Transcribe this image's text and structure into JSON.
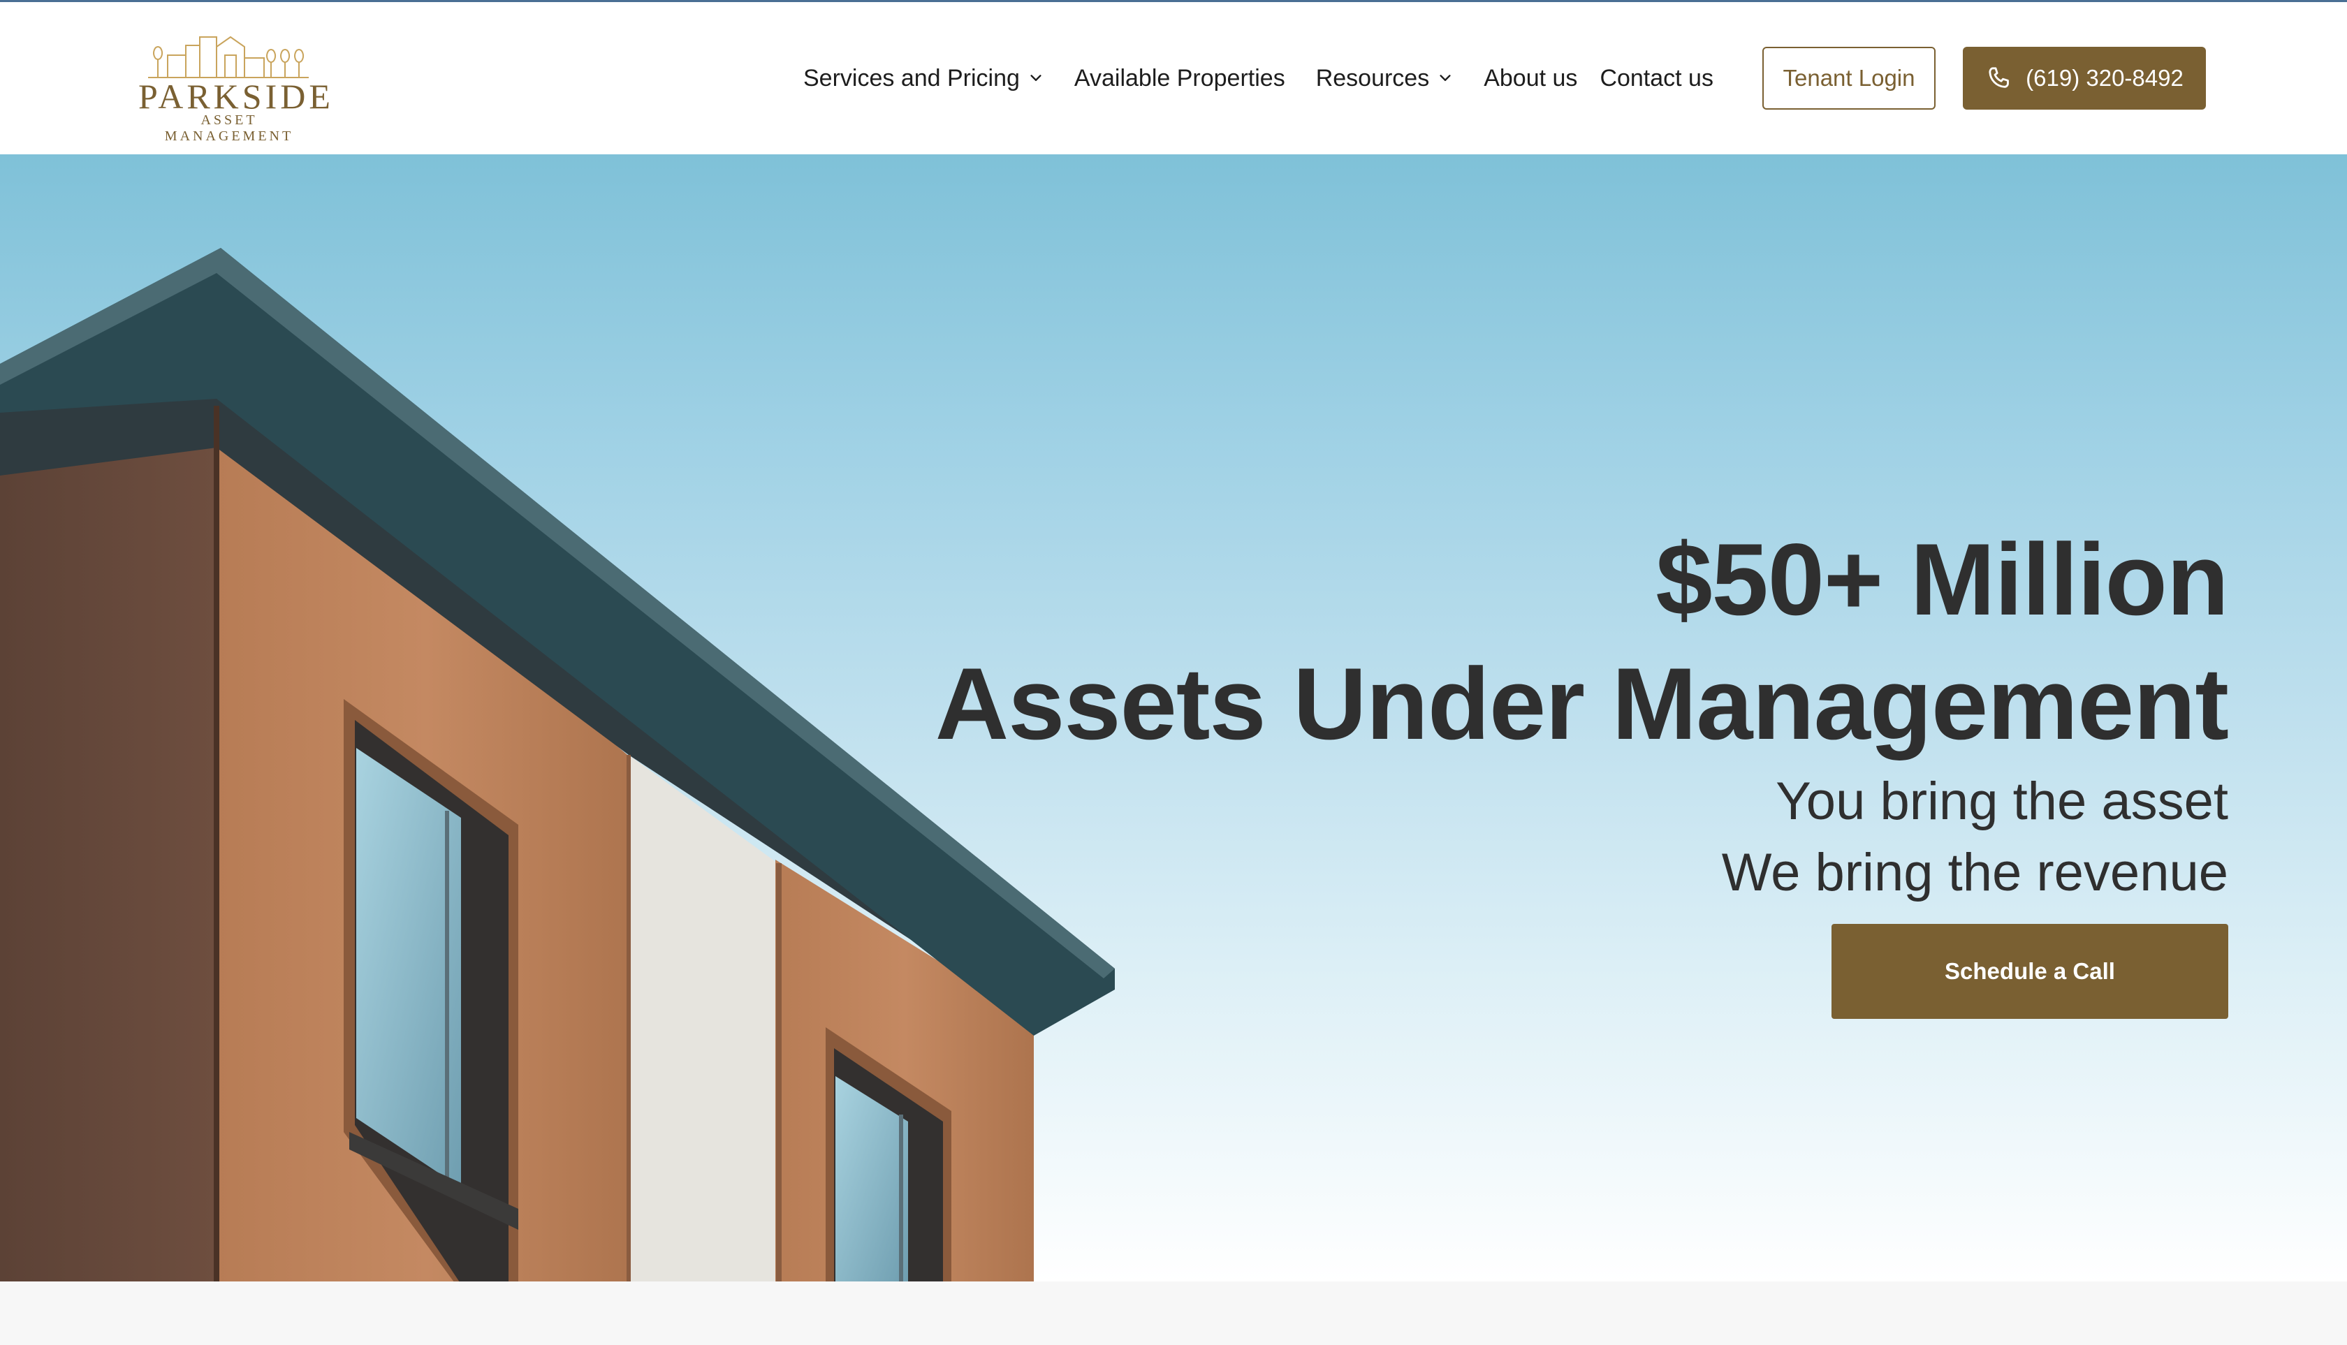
{
  "brand": {
    "name": "PARKSIDE",
    "tagline": "ASSET MANAGEMENT",
    "color": "#7a6032"
  },
  "nav": {
    "items": [
      {
        "label": "Services and Pricing",
        "has_dropdown": true
      },
      {
        "label": "Available Properties",
        "has_dropdown": false
      },
      {
        "label": "Resources",
        "has_dropdown": true
      },
      {
        "label": "About us",
        "has_dropdown": false
      },
      {
        "label": "Contact us",
        "has_dropdown": false
      }
    ],
    "tenant_login": "Tenant Login",
    "phone": "(619) 320-8492",
    "phone_icon": "phone-icon"
  },
  "hero": {
    "headline_line1": "$50+ Million",
    "headline_line2": "Assets Under Management",
    "subline1": "You bring the asset",
    "subline2": "We bring the revenue",
    "cta": "Schedule a Call"
  }
}
